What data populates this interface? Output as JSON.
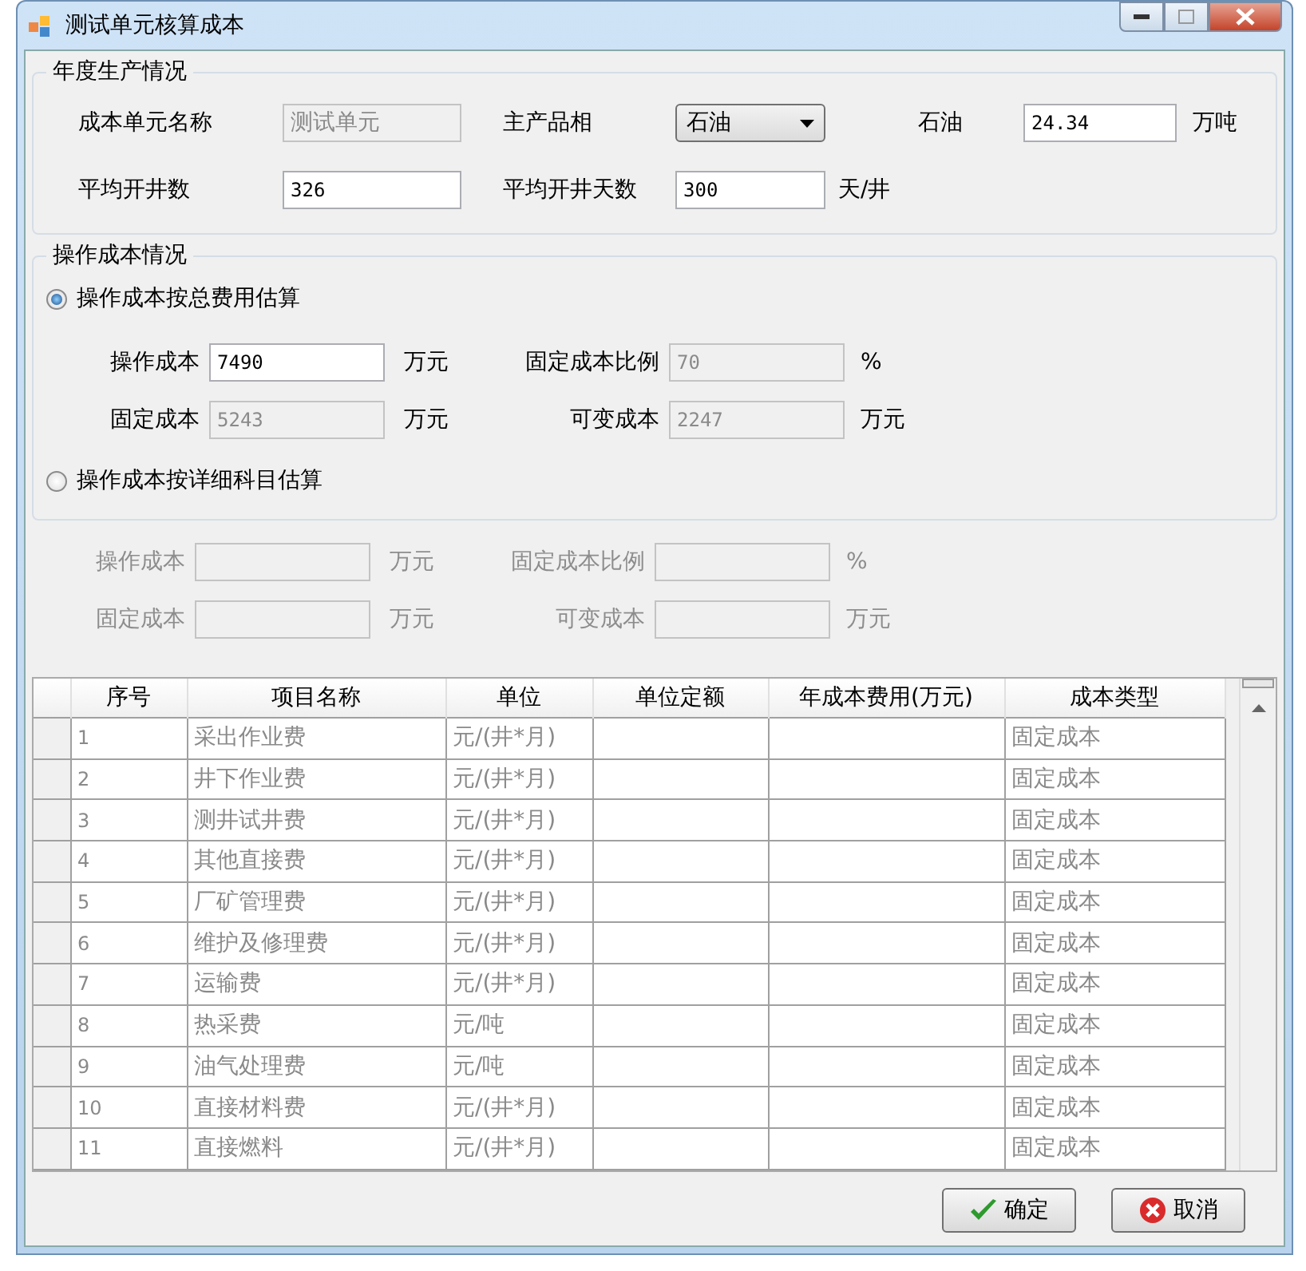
{
  "window": {
    "title": "测试单元核算成本"
  },
  "annual_production": {
    "title": "年度生产情况",
    "unit_name": {
      "label": "成本单元名称",
      "value": "测试单元",
      "disabled": true
    },
    "main_product": {
      "label": "主产品相",
      "value": "石油"
    },
    "output": {
      "label": "石油",
      "value": "24.34",
      "unit": "万吨"
    },
    "avg_wells": {
      "label": "平均开井数",
      "value": "326"
    },
    "avg_days": {
      "label": "平均开井天数",
      "value": "300",
      "unit": "天/井"
    }
  },
  "operating_cost": {
    "title": "操作成本情况",
    "options": [
      {
        "label": "操作成本按总费用估算",
        "selected": true,
        "fields": [
          {
            "label": "操作成本",
            "value": "7490",
            "unit": "万元",
            "disabled": false
          },
          {
            "label": "固定成本比例",
            "value": "70",
            "unit": "%",
            "disabled": true
          },
          {
            "label": "固定成本",
            "value": "5243",
            "unit": "万元",
            "disabled": true
          },
          {
            "label": "可变成本",
            "value": "2247",
            "unit": "万元",
            "disabled": true
          }
        ]
      },
      {
        "label": "操作成本按详细科目估算",
        "selected": false,
        "fields": [
          {
            "label": "操作成本",
            "unit": "万元",
            "disabled": true
          },
          {
            "label": "固定成本比例",
            "unit": "%",
            "disabled": true
          },
          {
            "label": "固定成本",
            "unit": "万元",
            "disabled": true
          },
          {
            "label": "可变成本",
            "unit": "万元",
            "disabled": true
          }
        ]
      }
    ]
  },
  "table": {
    "columns": [
      "序号",
      "项目名称",
      "单位",
      "单位定额",
      "年成本费用(万元)",
      "成本类型"
    ],
    "rows": [
      [
        "1",
        "采出作业费",
        "元/(井*月)",
        "",
        "",
        "固定成本"
      ],
      [
        "2",
        "井下作业费",
        "元/(井*月)",
        "",
        "",
        "固定成本"
      ],
      [
        "3",
        "测井试井费",
        "元/(井*月)",
        "",
        "",
        "固定成本"
      ],
      [
        "4",
        "其他直接费",
        "元/(井*月)",
        "",
        "",
        "固定成本"
      ],
      [
        "5",
        "厂矿管理费",
        "元/(井*月)",
        "",
        "",
        "固定成本"
      ],
      [
        "6",
        "维护及修理费",
        "元/(井*月)",
        "",
        "",
        "固定成本"
      ],
      [
        "7",
        "运输费",
        "元/(井*月)",
        "",
        "",
        "固定成本"
      ],
      [
        "8",
        "热采费",
        "元/吨",
        "",
        "",
        "固定成本"
      ],
      [
        "9",
        "油气处理费",
        "元/吨",
        "",
        "",
        "固定成本"
      ],
      [
        "10",
        "直接材料费",
        "元/(井*月)",
        "",
        "",
        "固定成本"
      ],
      [
        "11",
        "直接燃料",
        "元/(井*月)",
        "",
        "",
        "固定成本"
      ]
    ]
  },
  "buttons": [
    {
      "label": "确定",
      "kind": "ok"
    },
    {
      "label": "取消",
      "kind": "cancel"
    }
  ]
}
